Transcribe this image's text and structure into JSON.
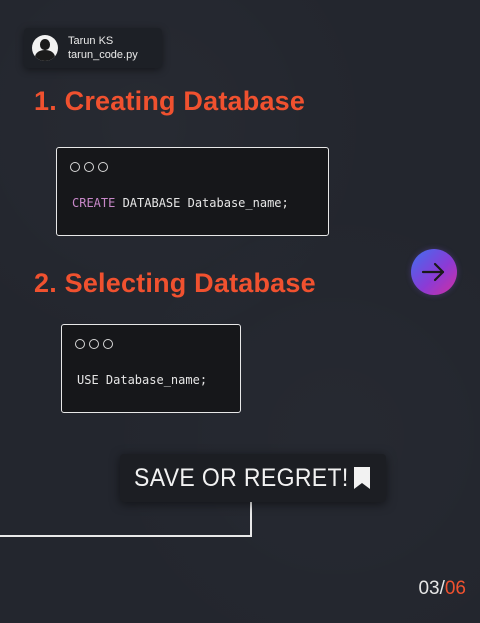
{
  "author": {
    "name": "Tarun KS",
    "handle": "tarun_code.py"
  },
  "sections": [
    {
      "title": "1. Creating Database",
      "code": {
        "keyword": "CREATE",
        "rest": " DATABASE Database_name;"
      }
    },
    {
      "title": "2. Selecting Database",
      "code": {
        "line": "USE Database_name;"
      }
    }
  ],
  "banner": {
    "text": "SAVE OR REGRET!",
    "icon": "bookmark-icon"
  },
  "navigation": {
    "icon": "arrow-right-icon"
  },
  "pagination": {
    "current": "03",
    "separator": "/",
    "total": "06"
  },
  "colors": {
    "background": "#23262e",
    "accent": "#f0512f",
    "code_keyword": "#c787c8"
  }
}
